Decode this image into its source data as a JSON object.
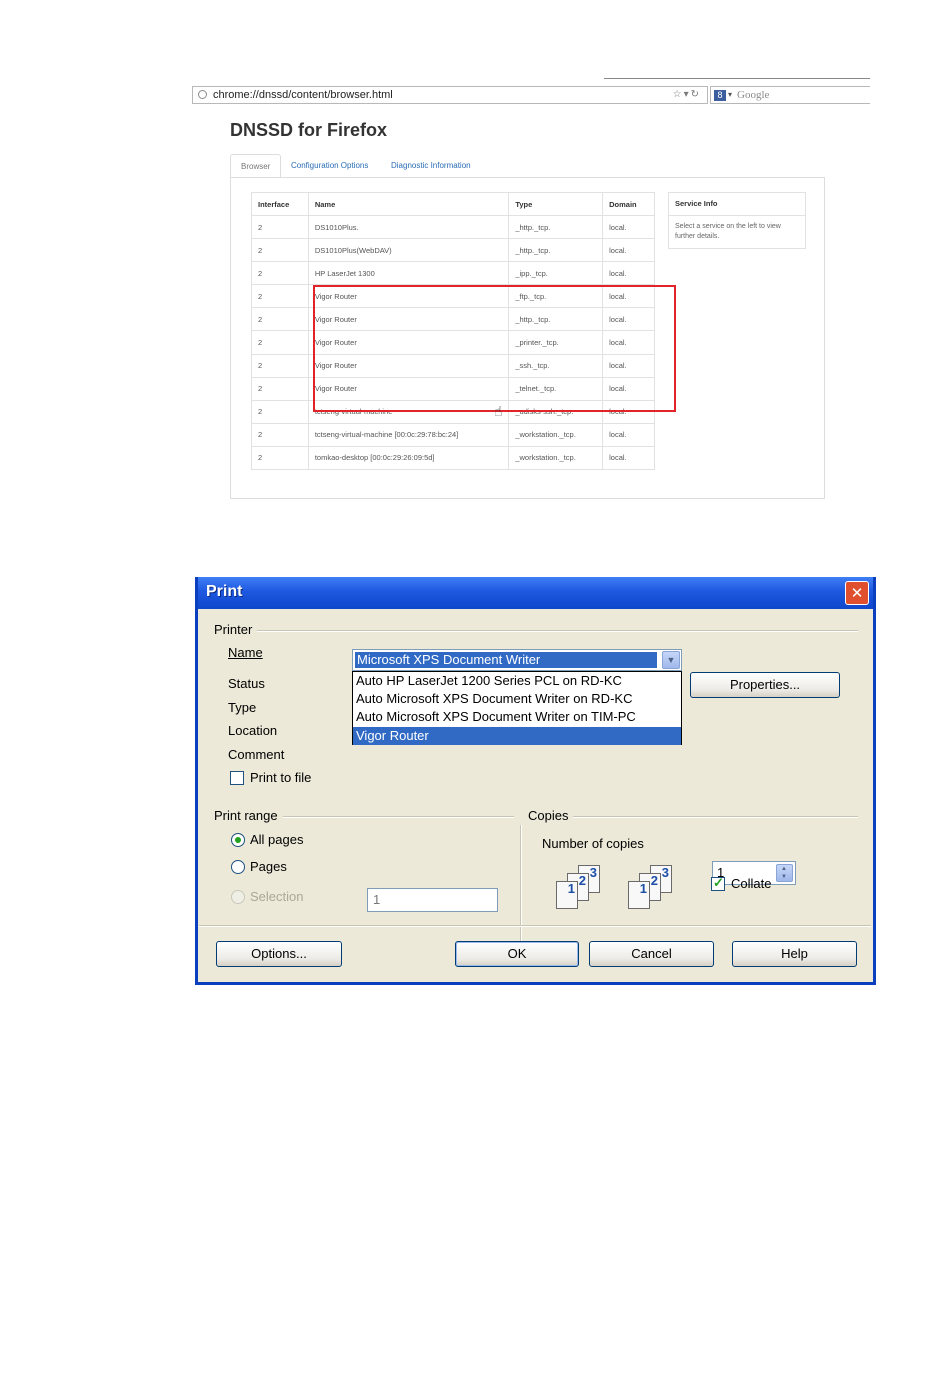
{
  "browser": {
    "address_bar": {
      "url": "chrome://dnssd/content/browser.html"
    },
    "search_bar": {
      "placeholder": "Google",
      "engine_badge": "8"
    },
    "page_title": "DNSSD for Firefox",
    "tabs": [
      {
        "label": "Browser",
        "active": true
      },
      {
        "label": "Configuration Options",
        "active": false
      },
      {
        "label": "Diagnostic Information",
        "active": false
      }
    ],
    "table": {
      "headers": [
        "Interface",
        "Name",
        "Type",
        "Domain"
      ],
      "rows": [
        [
          "2",
          "DS1010Plus.",
          "_http._tcp.",
          "local."
        ],
        [
          "2",
          "DS1010Plus(WebDAV)",
          "_http._tcp.",
          "local."
        ],
        [
          "2",
          "HP LaserJet 1300",
          "_ipp._tcp.",
          "local."
        ],
        [
          "2",
          "Vigor Router",
          "_ftp._tcp.",
          "local."
        ],
        [
          "2",
          "Vigor Router",
          "_http._tcp.",
          "local."
        ],
        [
          "2",
          "Vigor Router",
          "_printer._tcp.",
          "local."
        ],
        [
          "2",
          "Vigor Router",
          "_ssh._tcp.",
          "local."
        ],
        [
          "2",
          "Vigor Router",
          "_telnet._tcp.",
          "local."
        ],
        [
          "2",
          "tctseng-virtual-machine",
          "_udisks-ssh._tcp.",
          "local."
        ],
        [
          "2",
          "tctseng-virtual-machine [00:0c:29:78:bc:24]",
          "_workstation._tcp.",
          "local."
        ],
        [
          "2",
          "tomkao-desktop [00:0c:29:26:09:5d]",
          "_workstation._tcp.",
          "local."
        ]
      ]
    },
    "service_info": {
      "title": "Service Info",
      "body": "Select a service on the left to view further details."
    }
  },
  "print_dialog": {
    "title": "Print",
    "close_glyph": "✕",
    "printer": {
      "section_label": "Printer",
      "name_label": "Name",
      "selected_printer": "Microsoft XPS Document Writer",
      "dropdown_options": [
        "Auto HP LaserJet 1200 Series PCL on RD-KC",
        "Auto Microsoft XPS Document Writer on RD-KC",
        "Auto Microsoft XPS Document Writer on TIM-PC",
        "Vigor Router"
      ],
      "highlighted_option": "Vigor Router",
      "properties_button": "Properties...",
      "status_label": "Status",
      "type_label": "Type",
      "location_label": "Location",
      "comment_label": "Comment",
      "print_to_file_label": "Print to file",
      "print_to_file_checked": false
    },
    "print_range": {
      "section_label": "Print range",
      "all_pages_label": "All pages",
      "pages_label": "Pages",
      "selection_label": "Selection",
      "selected": "All pages",
      "pages_value": "1"
    },
    "copies": {
      "section_label": "Copies",
      "number_label": "Number of copies",
      "value": "1",
      "collate_label": "Collate",
      "collate_checked": true,
      "collate_icon_pages": [
        "1",
        "2",
        "3"
      ]
    },
    "buttons": {
      "options": "Options...",
      "ok": "OK",
      "cancel": "Cancel",
      "help": "Help"
    }
  },
  "colors": {
    "link": "#2a6db5",
    "highlight_box": "#e0242a",
    "xp_titlebar": "#1d58e0",
    "xp_selection": "#316ac5",
    "dialog_face": "#ece9d8"
  }
}
